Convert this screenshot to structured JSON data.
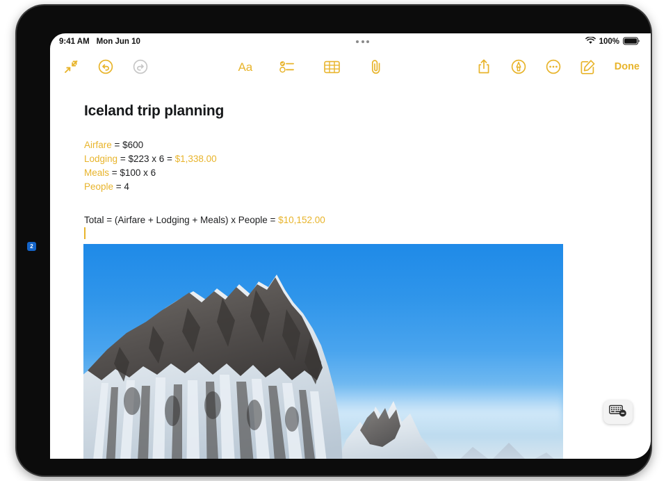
{
  "status_bar": {
    "time": "9:41 AM",
    "date": "Mon Jun 10",
    "battery_percent": "100%",
    "wifi_icon": "wifi-icon",
    "battery_icon": "battery-full-icon",
    "multitask_handle_icon": "multitask-handle-icon"
  },
  "toolbar": {
    "left": [
      {
        "name": "collapse-arrows-icon",
        "label": "Collapse",
        "color": "#E8B42B"
      },
      {
        "name": "undo-icon",
        "label": "Undo",
        "color": "#E8B42B"
      },
      {
        "name": "redo-icon",
        "label": "Redo",
        "color": "#C7C7C7"
      }
    ],
    "center": [
      {
        "name": "format-icon",
        "label": "Aa"
      },
      {
        "name": "checklist-icon",
        "label": "Checklist"
      },
      {
        "name": "table-icon",
        "label": "Table"
      },
      {
        "name": "attachment-icon",
        "label": "Attach"
      }
    ],
    "right": [
      {
        "name": "share-icon",
        "label": "Share"
      },
      {
        "name": "markup-icon",
        "label": "Markup"
      },
      {
        "name": "more-icon",
        "label": "More"
      },
      {
        "name": "compose-icon",
        "label": "New Note"
      }
    ],
    "done_label": "Done"
  },
  "note": {
    "title": "Iceland trip planning",
    "calc_lines": [
      {
        "variable": "Airfare",
        "expression": " = $600",
        "result": ""
      },
      {
        "variable": "Lodging",
        "expression": " = $223 x 6  = ",
        "result": "$1,338.00"
      },
      {
        "variable": "Meals",
        "expression": " = $100 x 6",
        "result": ""
      },
      {
        "variable": "People",
        "expression": " = 4",
        "result": ""
      }
    ],
    "total_expression": "Total = (Airfare + Lodging + Meals)  x People  = ",
    "total_result": "$10,152.00",
    "photo_alt": "Snow-covered mountain under blue sky in Iceland"
  },
  "floating": {
    "keyboard_dismiss_icon": "keyboard-dismiss-icon"
  },
  "annotation": {
    "callout_2": "2"
  },
  "colors": {
    "accent_gold": "#E8B42B",
    "disabled_gray": "#C7C7C7",
    "text_black": "#1c1d1f",
    "callout_blue": "#1464c8"
  }
}
